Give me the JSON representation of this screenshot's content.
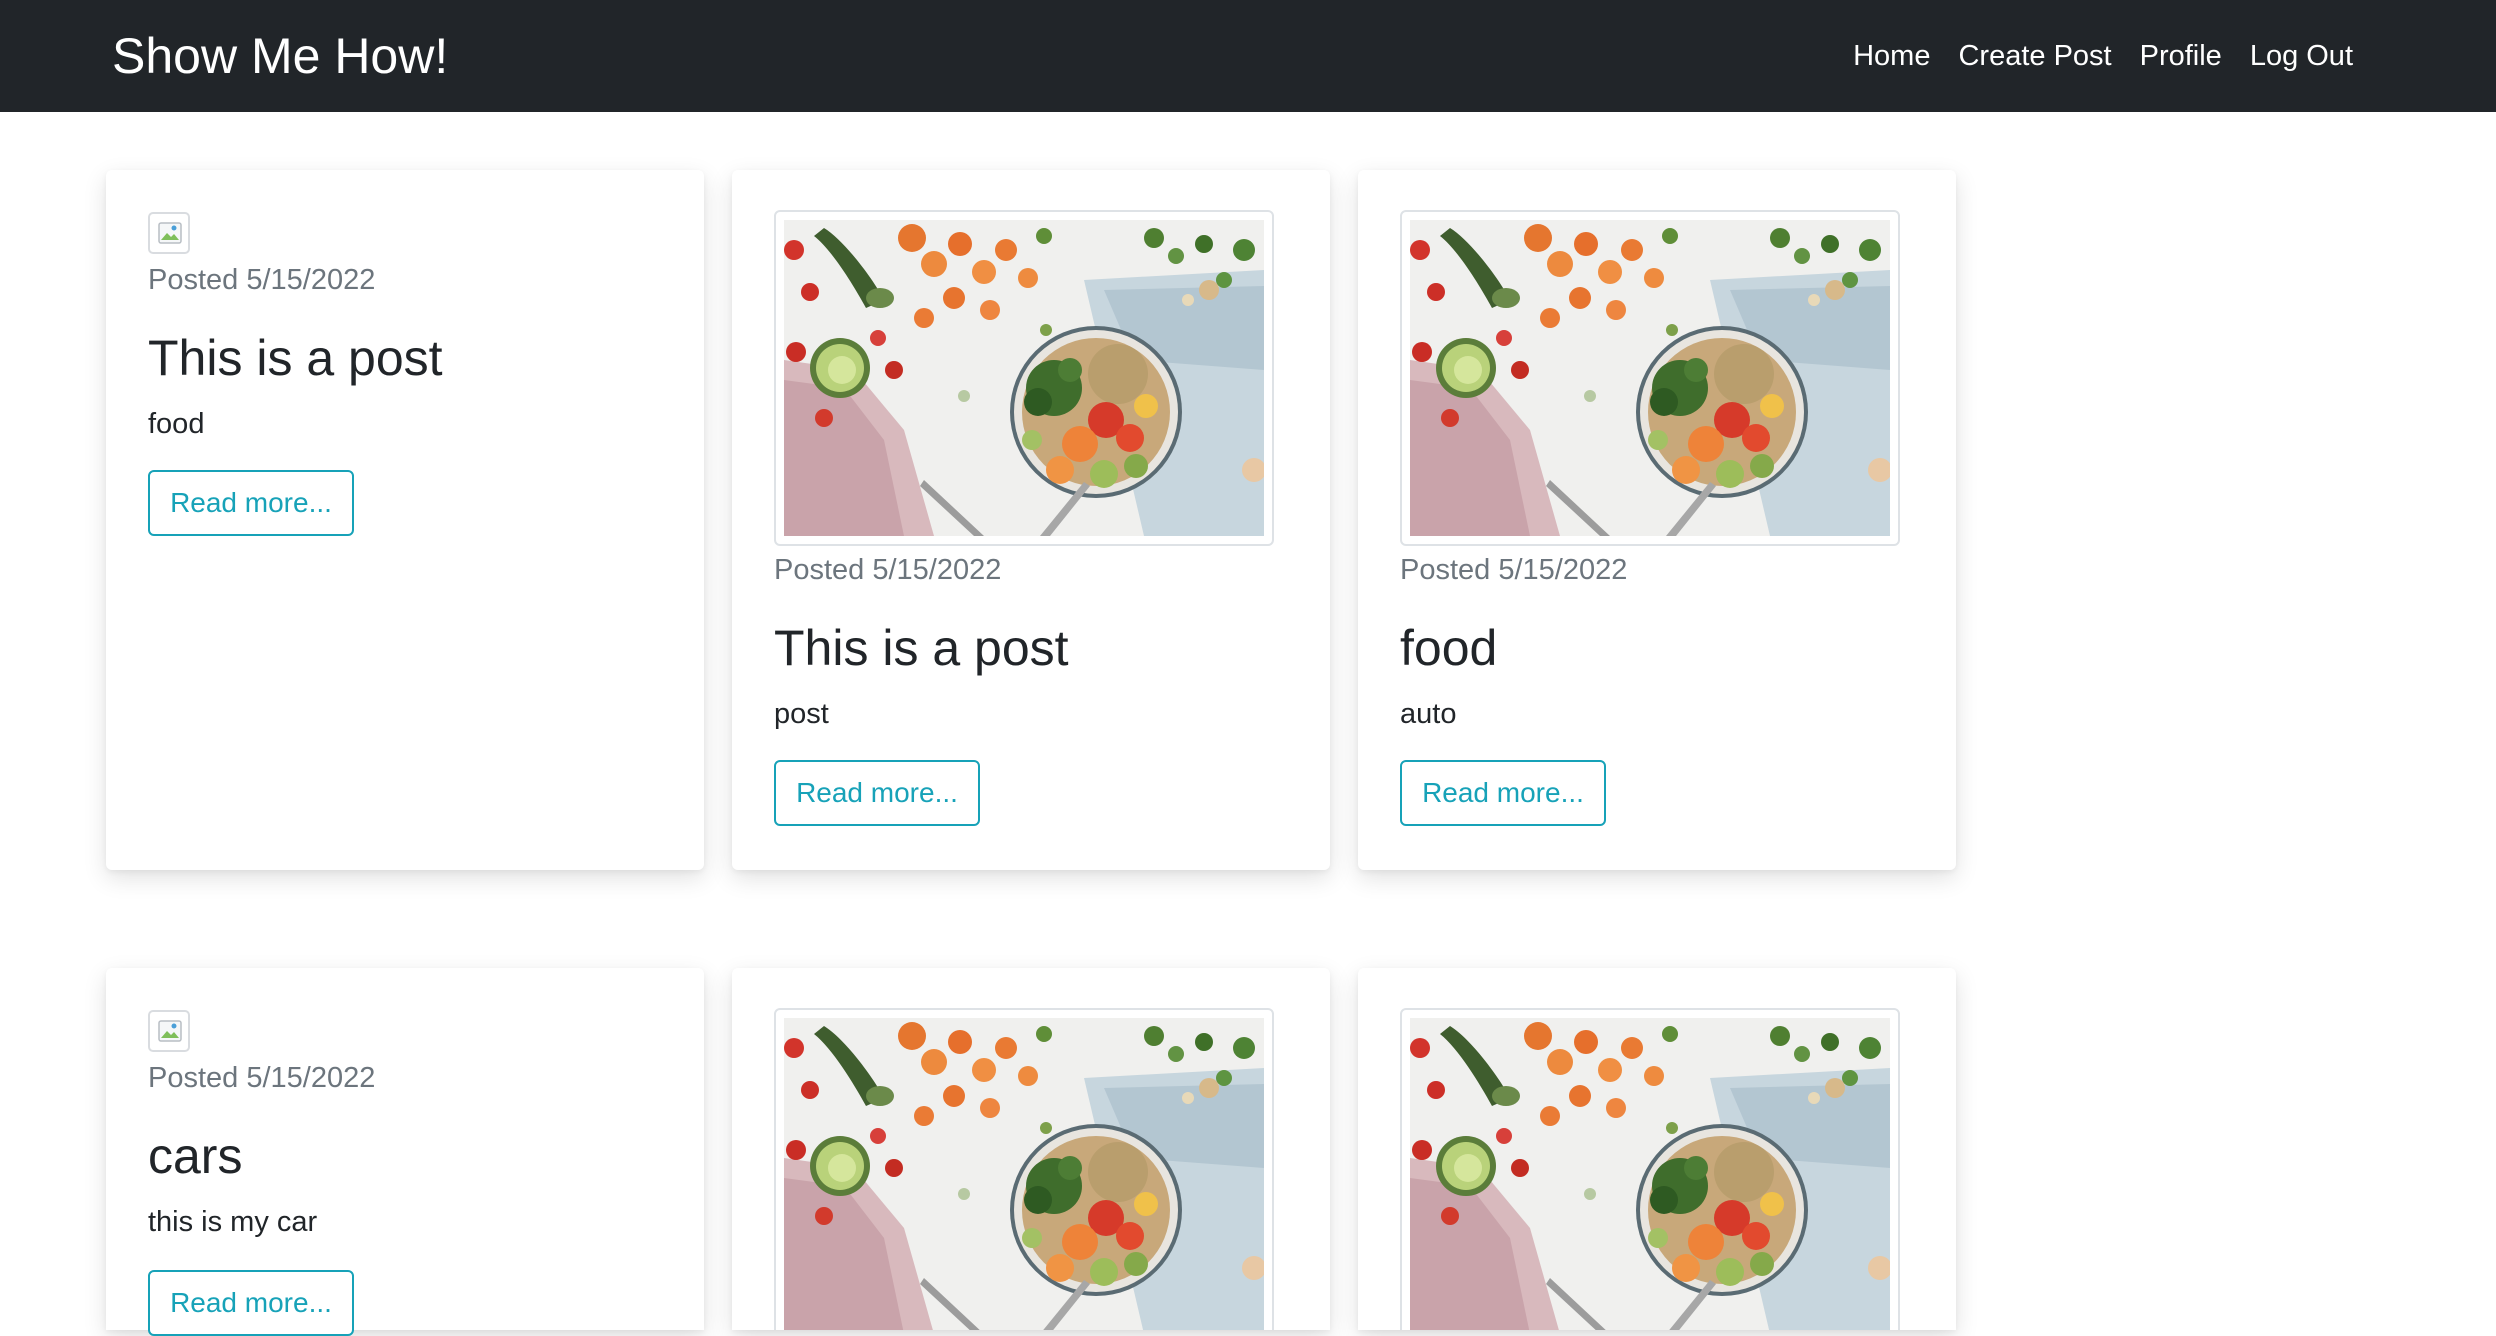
{
  "navbar": {
    "brand": "Show Me How!",
    "links": [
      "Home",
      "Create Post",
      "Profile",
      "Log Out"
    ]
  },
  "posts": [
    {
      "posted": "Posted 5/15/2022",
      "title": "This is a post",
      "text": "food",
      "button": "Read more...",
      "image": "broken-image-icon"
    },
    {
      "posted": "Posted 5/15/2022",
      "title": "This is a post",
      "text": "post",
      "button": "Read more...",
      "image": "food-bowl-photo"
    },
    {
      "posted": "Posted 5/15/2022",
      "title": "food",
      "text": "auto",
      "button": "Read more...",
      "image": "food-bowl-photo"
    },
    {
      "posted": "Posted 5/15/2022",
      "title": "cars",
      "text": "this is my car",
      "button": "Read more...",
      "image": "broken-image-icon"
    },
    {
      "image": "food-bowl-photo"
    },
    {
      "image": "food-bowl-photo"
    }
  ],
  "colors": {
    "navbar_bg": "#212529",
    "muted_text": "#6c757d",
    "button_info": "#17a2b8"
  }
}
